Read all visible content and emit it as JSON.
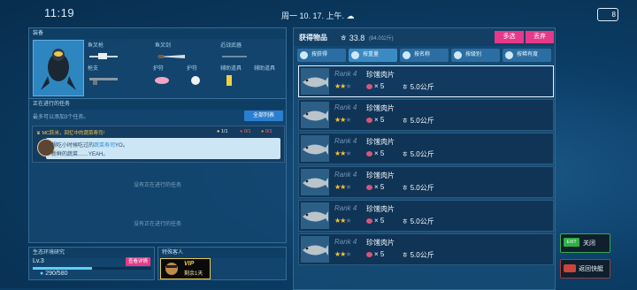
{
  "status_bar": {
    "time": "11:19",
    "date": "周一 10. 17. 上午."
  },
  "battery": {
    "level": "8"
  },
  "equipment": {
    "header": "装备",
    "slots": [
      {
        "label": "鱼叉枪",
        "icon": "speargun-icon"
      },
      {
        "label": "鱼叉剑",
        "icon": "fish-sword-icon"
      },
      {
        "label": "近战武器",
        "icon": "melee-weapon-icon"
      },
      {
        "label": "枪支",
        "icon": "rifle-icon"
      },
      {
        "label": "护符",
        "icon": "dolphin-charm-icon"
      },
      {
        "label": "护符",
        "icon": "hedgehog-charm-icon"
      },
      {
        "label": "辅助道具",
        "icon": "bottle-icon"
      },
      {
        "label": "辅助道具",
        "icon": "empty-slot"
      }
    ]
  },
  "tasks": {
    "header": "正在进行的任务",
    "subtitle": "最多可以添加3个任务。",
    "all_list_label": "全部列表",
    "card": {
      "title": "MC跃米，回忆中的蔬菜寿司!",
      "counts": [
        "1/1",
        "0/1",
        "0/1"
      ],
      "line1_prefix": "想吃小时候吃过的",
      "line1_highlight": "蔬菜寿司",
      "line1_suffix": "YO。",
      "line2": "新鲜的蔬菜……YEAH。"
    },
    "empty_1": "没有正在进行的任务",
    "empty_2": "没有正在进行的任务"
  },
  "eco": {
    "header": "生态环境研究",
    "level": "Lv.3",
    "detail_label": "查看详情",
    "value": "290/580",
    "progress": 0.5
  },
  "guest": {
    "header": "特殊客人",
    "vip_label": "VIP",
    "days": "剩余1天"
  },
  "items": {
    "title": "获得物品",
    "weight": "33.8",
    "capacity": "(84.0公斤)",
    "multi_select": "多选",
    "discard": "丢弃",
    "sort_tabs": [
      "按获得",
      "按重量",
      "按名称",
      "按级别",
      "按稀有度"
    ],
    "rows": [
      {
        "rank": "Rank 4",
        "name": "珍馐肉片",
        "stars": 2,
        "qty": "× 5",
        "weight": "5.0公斤"
      },
      {
        "rank": "Rank 4",
        "name": "珍馐肉片",
        "stars": 2,
        "qty": "× 5",
        "weight": "5.0公斤"
      },
      {
        "rank": "Rank 4",
        "name": "珍馐肉片",
        "stars": 2,
        "qty": "× 5",
        "weight": "5.0公斤"
      },
      {
        "rank": "Rank 4",
        "name": "珍馐肉片",
        "stars": 2,
        "qty": "× 5",
        "weight": "5.0公斤"
      },
      {
        "rank": "Rank 4",
        "name": "珍馐肉片",
        "stars": 2,
        "qty": "× 5",
        "weight": "5.0公斤"
      },
      {
        "rank": "Rank 4",
        "name": "珍馐肉片",
        "stars": 2,
        "qty": "× 5",
        "weight": "5.0公斤"
      }
    ],
    "weight_symbol": "ㅎ"
  },
  "buttons": {
    "exit_tag": "EXIT",
    "close_label": "关闭",
    "return_label": "返回快艇"
  },
  "colors": {
    "accent_pink": "#e6398a",
    "star_gold": "#f6c432",
    "exit_green": "#2fae45"
  }
}
